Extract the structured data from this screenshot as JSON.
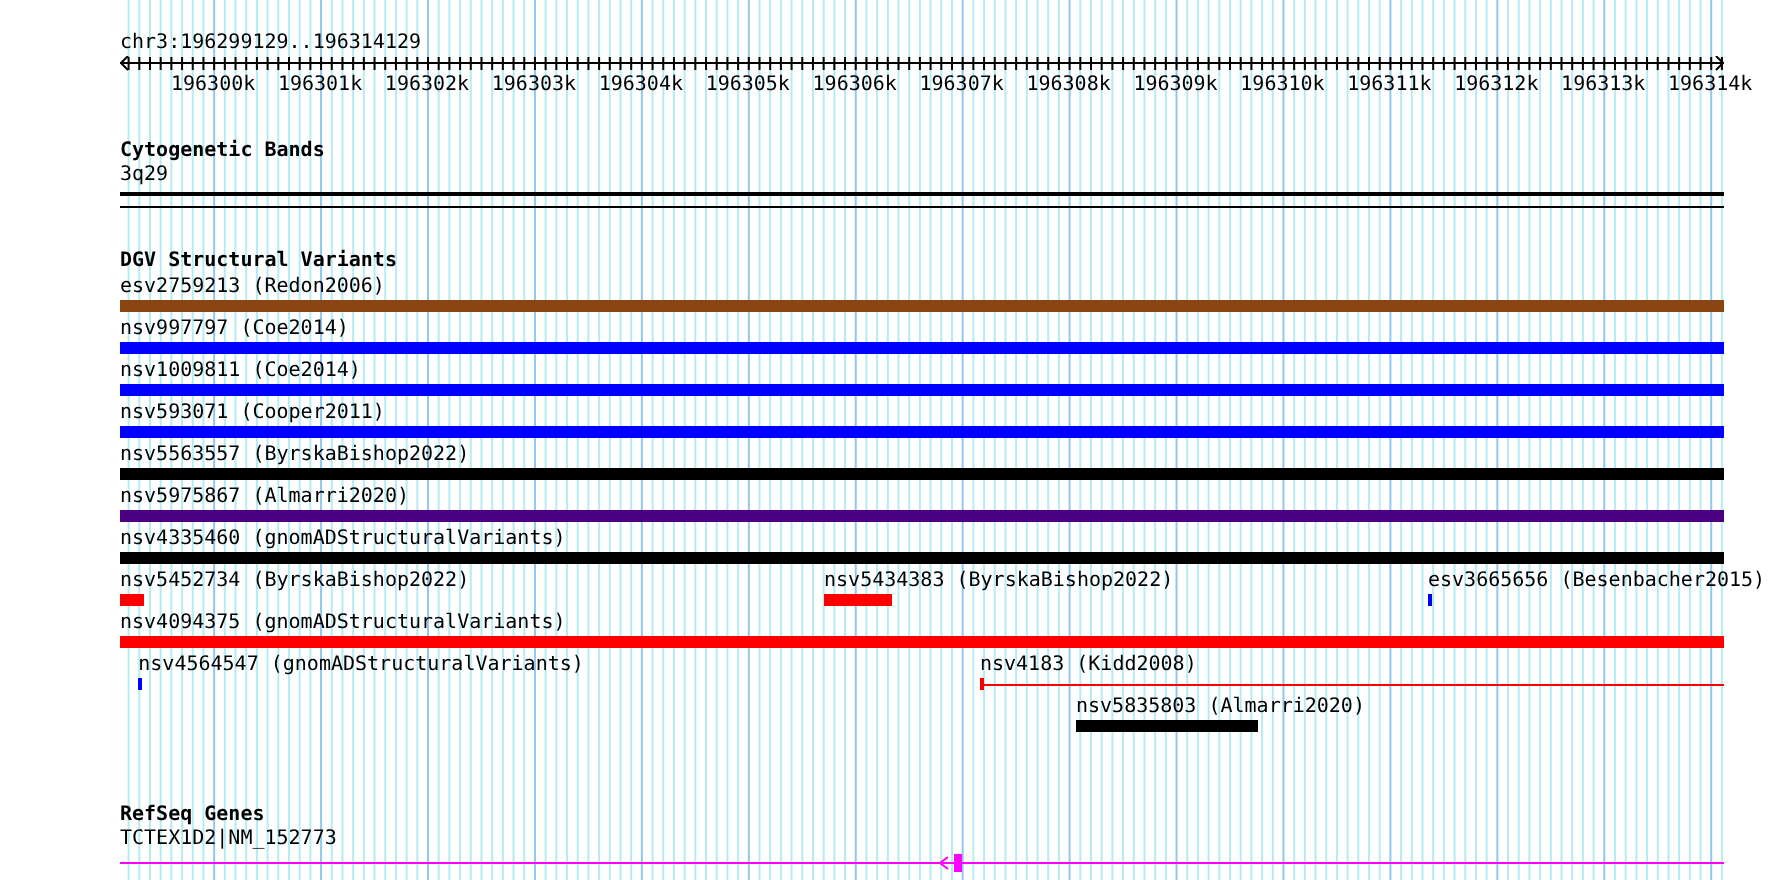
{
  "ruler": {
    "location": "chr3:196299129..196314129",
    "ticks": [
      "196300k",
      "196301k",
      "196302k",
      "196303k",
      "196304k",
      "196305k",
      "196306k",
      "196307k",
      "196308k",
      "196309k",
      "196310k",
      "196311k",
      "196312k",
      "196313k",
      "196314k"
    ]
  },
  "tracks": [
    {
      "kind": "cytoband",
      "title": "Cytogenetic Bands",
      "label": "3q29"
    },
    {
      "kind": "variants",
      "title": "DGV Structural Variants",
      "rows": [
        [
          {
            "label": "esv2759213 (Redon2006)",
            "kind": "bar",
            "color": "#8b4513"
          }
        ],
        [
          {
            "label": "nsv997797 (Coe2014)",
            "kind": "bar",
            "color": "#0000ff"
          }
        ],
        [
          {
            "label": "nsv1009811 (Coe2014)",
            "kind": "bar",
            "color": "#0000ff"
          }
        ],
        [
          {
            "label": "nsv593071 (Cooper2011)",
            "kind": "bar",
            "color": "#0000ff"
          }
        ],
        [
          {
            "label": "nsv5563557 (ByrskaBishop2022)",
            "kind": "bar",
            "color": "#000000"
          }
        ],
        [
          {
            "label": "nsv5975867 (Almarri2020)",
            "kind": "bar",
            "color": "#4b0082"
          }
        ],
        [
          {
            "label": "nsv4335460 (gnomADStructuralVariants)",
            "kind": "bar",
            "color": "#000000"
          }
        ],
        [
          {
            "label": "nsv5452734 (ByrskaBishop2022)",
            "kind": "bar",
            "color": "#ff0000"
          },
          {
            "label": "nsv5434383 (ByrskaBishop2022)",
            "kind": "bar",
            "color": "#ff0000"
          },
          {
            "label": "esv3665656 (Besenbacher2015)",
            "kind": "bar",
            "color": "#0000ff"
          }
        ],
        [
          {
            "label": "nsv4094375 (gnomADStructuralVariants)",
            "kind": "bar",
            "color": "#ff0000"
          }
        ],
        [
          {
            "label": "nsv4564547 (gnomADStructuralVariants)",
            "kind": "bar",
            "color": "#0000ff"
          },
          {
            "label": "nsv4183 (Kidd2008)",
            "kind": "line",
            "color": "#ff0000"
          }
        ],
        [
          {
            "label": "nsv5835803 (Almarri2020)",
            "kind": "bar",
            "color": "#000000"
          }
        ]
      ]
    },
    {
      "kind": "gene",
      "title": "RefSeq Genes",
      "label": "TCTEX1D2|NM_152773",
      "color": "#ff00ff"
    }
  ]
}
